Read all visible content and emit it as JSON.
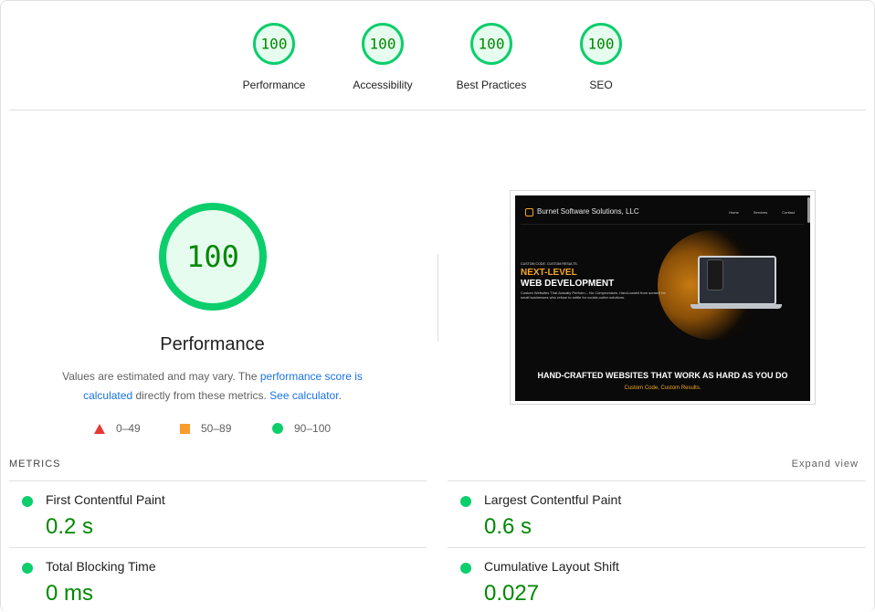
{
  "categories": [
    {
      "score": "100",
      "label": "Performance"
    },
    {
      "score": "100",
      "label": "Accessibility"
    },
    {
      "score": "100",
      "label": "Best Practices"
    },
    {
      "score": "100",
      "label": "SEO"
    }
  ],
  "performance": {
    "score": "100",
    "title": "Performance",
    "desc_part1": "Values are estimated and may vary. The ",
    "desc_link1": "performance score is calculated",
    "desc_part2": " directly from these metrics. ",
    "desc_link2": "See calculator",
    "desc_part3": "."
  },
  "legend": {
    "fail": "0–49",
    "average": "50–89",
    "pass": "90–100"
  },
  "screenshot": {
    "brand": "Burnet Software Solutions, LLC",
    "nav": [
      "Home",
      "Services",
      "Contact"
    ],
    "tagline": "CUSTOM CODE. CUSTOM RESULTS.",
    "heading_line1": "NEXT-LEVEL",
    "heading_line2": "WEB DEVELOPMENT",
    "body": "Custom Websites That Actually Perform – No Compromises. Hand-coded from scratch for small businesses who refuse to settle for cookie-cutter solutions.",
    "headline": "HAND-CRAFTED WEBSITES THAT WORK AS HARD AS YOU DO",
    "subline": "Custom Code, Custom Results."
  },
  "metrics": {
    "label": "METRICS",
    "expand": "Expand view",
    "items": [
      {
        "name": "First Contentful Paint",
        "value": "0.2 s"
      },
      {
        "name": "Largest Contentful Paint",
        "value": "0.6 s"
      },
      {
        "name": "Total Blocking Time",
        "value": "0 ms"
      },
      {
        "name": "Cumulative Layout Shift",
        "value": "0.027"
      }
    ]
  },
  "colors": {
    "pass": "#0cce6b",
    "pass_text": "#008800",
    "pass_bg": "#e6fcef",
    "average": "#fa9c2b",
    "fail": "#e53935",
    "link": "#1a73e8"
  }
}
